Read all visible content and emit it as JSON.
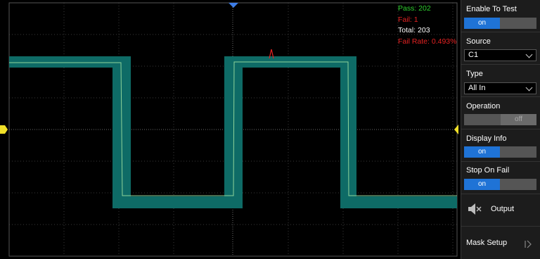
{
  "stats": {
    "pass": "Pass: 202",
    "fail": "Fail: 1",
    "total": "Total: 203",
    "fail_rate": "Fail Rate: 0.493%"
  },
  "colors": {
    "pass": "#2fd12f",
    "fail": "#e52222",
    "total": "#ffffff",
    "mask": "#0e6b66",
    "trace": "#8fd49a",
    "accent": "#1f73d6"
  },
  "panel": {
    "enable_to_test": {
      "label": "Enable To Test",
      "on": "on",
      "off": ""
    },
    "source": {
      "label": "Source",
      "value": "C1"
    },
    "type": {
      "label": "Type",
      "value": "All In"
    },
    "operation": {
      "label": "Operation",
      "on": "",
      "off": "off"
    },
    "display_info": {
      "label": "Display Info",
      "on": "on",
      "off": ""
    },
    "stop_on_fail": {
      "label": "Stop On Fail",
      "on": "on",
      "off": ""
    },
    "output": {
      "label": "Output",
      "icon": "speaker-muted-icon"
    },
    "mask_setup": {
      "label": "Mask Setup",
      "icon": "next-page-icon"
    }
  }
}
